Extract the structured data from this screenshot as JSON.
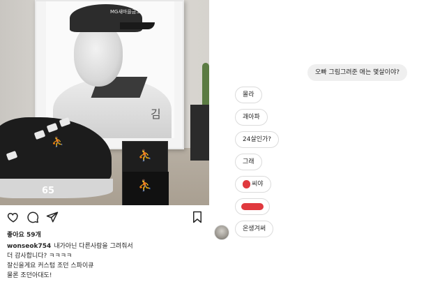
{
  "post": {
    "cap_logo_text": "MG새마을금고",
    "shoe_number": "65",
    "jersey_mark": "김",
    "likes": "좋아요 59개",
    "caption": {
      "username": "wonseok754",
      "lines": [
        "내가아닌 다른사람을 그려줘서",
        "더 감사합니다? ㅋㅋㅋㅋ",
        "잘신을게요 커스텀 조던 스파이큐",
        "물론 조던아대도!"
      ]
    },
    "icons": {
      "like": "heart-icon",
      "comment": "comment-icon",
      "share": "send-icon",
      "save": "bookmark-icon"
    }
  },
  "chat": {
    "outgoing": "오빠 그림그려준 애는 몇살이야?",
    "replies": [
      "몰라",
      "괘아파",
      "24살인가?",
      "그래",
      "씨야",
      "",
      "온생겨써"
    ]
  },
  "colors": {
    "redaction": "#e0393e",
    "outgoing_bubble": "#efefef",
    "bubble_border": "#dbdbdb"
  }
}
